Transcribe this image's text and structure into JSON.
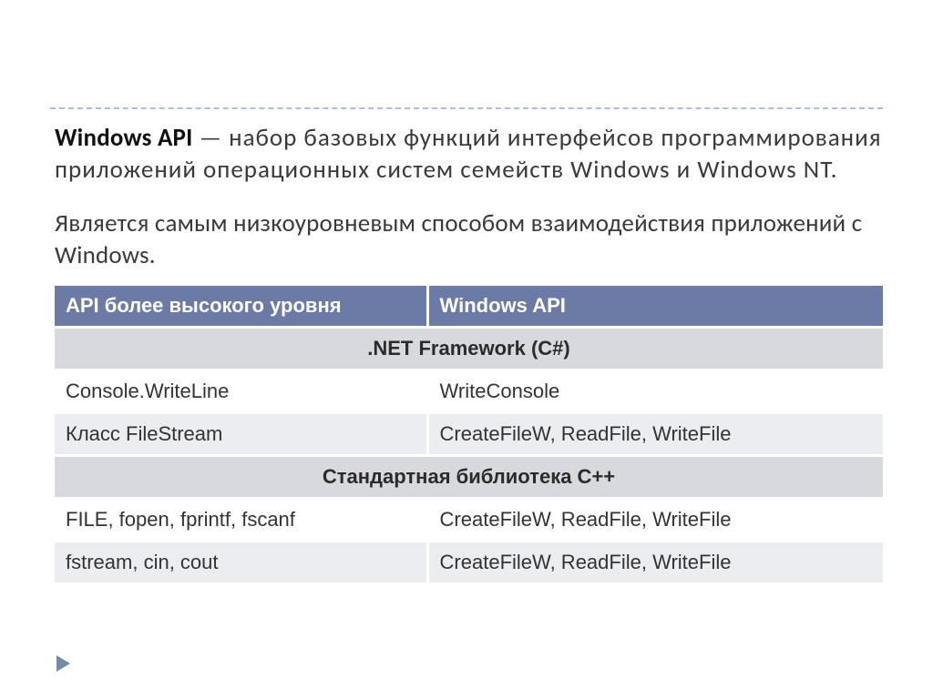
{
  "paragraphs": {
    "p1_strong": "Windows API",
    "p1_rest": "  — набор базовых функций интерфейсов программирования приложений операционных систем семейств Windows и Windows NT.",
    "p2": "Является самым низкоуровневым способом взаимодействия приложений с Windows."
  },
  "table": {
    "headers": {
      "col1": "API более высокого уровня",
      "col2": "Windows API"
    },
    "section1": ".NET Framework (C#)",
    "rows1": [
      {
        "left": "Console.WriteLine",
        "right": "WriteConsole"
      },
      {
        "left": "Класс FileStream",
        "right": "CreateFileW, ReadFile, WriteFile"
      }
    ],
    "section2": "Стандартная библиотека C++",
    "rows2": [
      {
        "left": "FILE, fopen, fprintf, fscanf",
        "right": "CreateFileW, ReadFile, WriteFile"
      },
      {
        "left": "fstream, cin, cout",
        "right": "CreateFileW, ReadFile, WriteFile"
      }
    ]
  }
}
